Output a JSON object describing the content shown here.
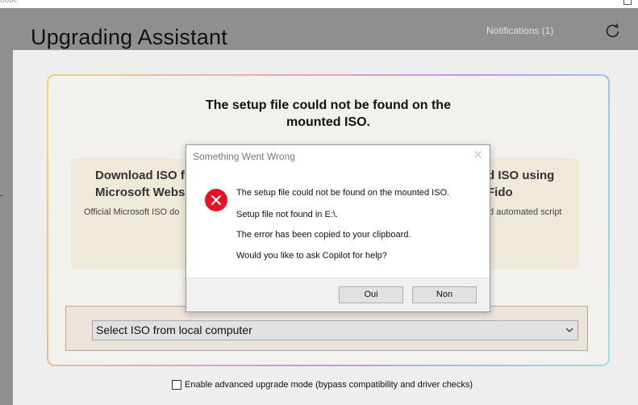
{
  "host_window": {
    "partial_title": "oobe"
  },
  "app": {
    "title": "Upgrading Assistant",
    "notifications_label": "Notifications (1)",
    "refresh_icon": "refresh-icon"
  },
  "main": {
    "heading": "The setup file could not be found on the mounted ISO.",
    "card_left": {
      "title_line1": "Download ISO fr",
      "title_line2": "Microsoft Webs",
      "description": "Official Microsoft ISO do"
    },
    "card_right": {
      "title_line1": "d ISO using",
      "title_line2": "Fido",
      "description": "d automated script"
    },
    "iso_select": {
      "selected": "Select ISO from local computer"
    },
    "advanced_mode": {
      "label": "Enable advanced upgrade mode (bypass compatibility and driver checks)",
      "checked": false
    }
  },
  "dialog": {
    "title": "Something Went Wrong",
    "close_glyph": "✕",
    "icon": "error-icon",
    "lines": [
      "The setup file could not be found on the mounted ISO.",
      "Setup file not found in E:\\.",
      "The error has been copied to your clipboard.",
      "Would you like to ask Copilot for help?"
    ],
    "buttons": {
      "yes": "Oui",
      "no": "Non"
    }
  },
  "colors": {
    "error_red": "#e81123",
    "card_bg": "#efe9d9",
    "panel_bg": "#f3f1ed"
  }
}
